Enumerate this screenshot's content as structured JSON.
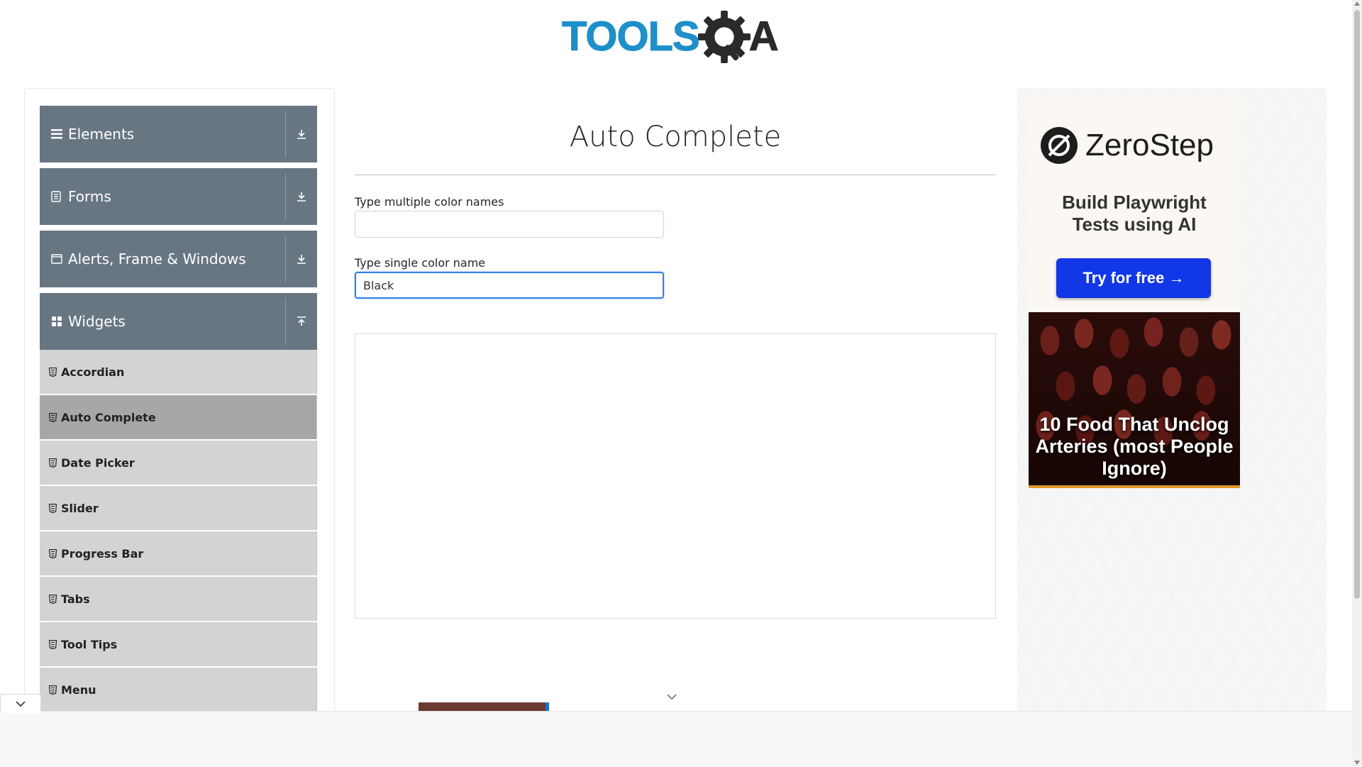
{
  "header": {
    "logo_part1": "TOOLS",
    "logo_part2": "A"
  },
  "sidebar": {
    "groups": [
      {
        "label": "Elements",
        "icon": "list-icon",
        "expanded": false
      },
      {
        "label": "Forms",
        "icon": "document-icon",
        "expanded": false
      },
      {
        "label": "Alerts, Frame & Windows",
        "icon": "window-icon",
        "expanded": false
      },
      {
        "label": "Widgets",
        "icon": "grid-icon",
        "expanded": true
      }
    ],
    "items": [
      {
        "label": "Accordian",
        "active": false
      },
      {
        "label": "Auto Complete",
        "active": true
      },
      {
        "label": "Date Picker",
        "active": false
      },
      {
        "label": "Slider",
        "active": false
      },
      {
        "label": "Progress Bar",
        "active": false
      },
      {
        "label": "Tabs",
        "active": false
      },
      {
        "label": "Tool Tips",
        "active": false
      },
      {
        "label": "Menu",
        "active": false
      }
    ]
  },
  "main": {
    "title": "Auto Complete",
    "multiple": {
      "label": "Type multiple color names",
      "value": ""
    },
    "single": {
      "label": "Type single color name",
      "value": "Black"
    }
  },
  "ad": {
    "brand": "ZeroStep",
    "tagline_line1": "Build Playwright",
    "tagline_line2": "Tests using AI",
    "button": "Try for free →",
    "food_title": "10 Food That Unclog Arteries (most People Ignore)"
  },
  "colors": {
    "sidebar_header": "#687682",
    "menu_item": "#d3d3d3",
    "menu_active": "#a7a7a7",
    "focus": "#2f80ed",
    "ad_button": "#1237e6",
    "logo_blue": "#1f8fc9"
  }
}
